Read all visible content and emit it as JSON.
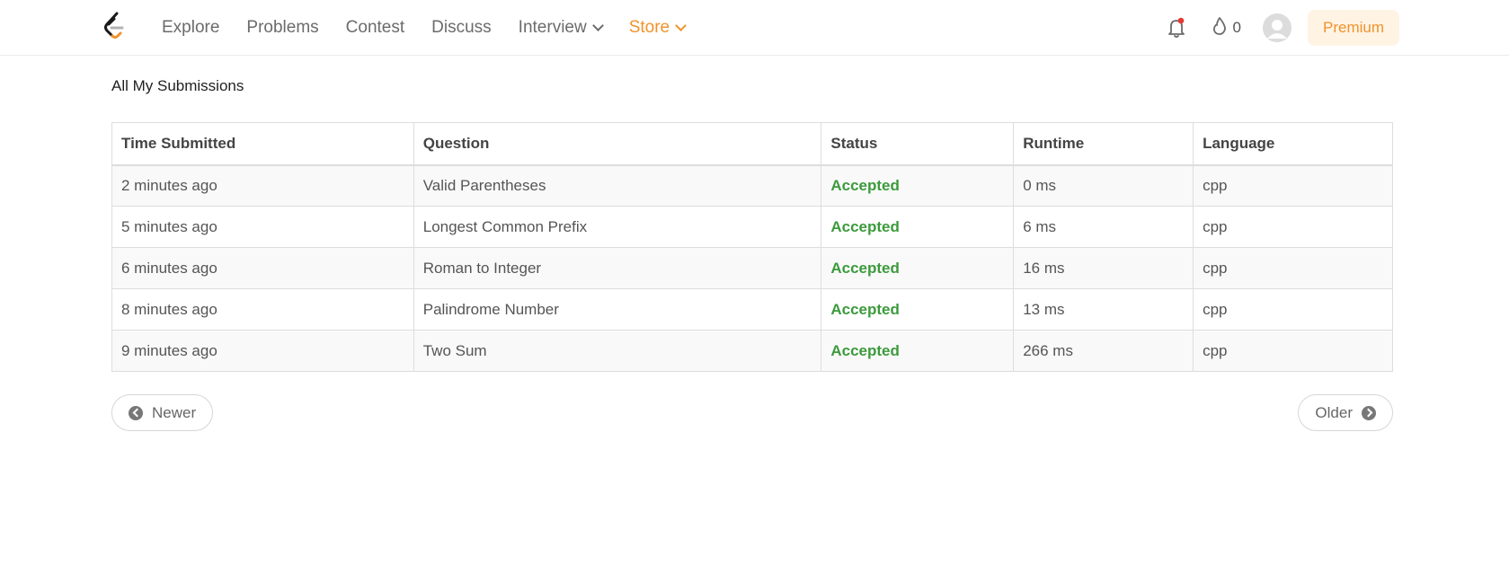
{
  "nav": {
    "items": [
      {
        "label": "Explore",
        "dropdown": false
      },
      {
        "label": "Problems",
        "dropdown": false
      },
      {
        "label": "Contest",
        "dropdown": false
      },
      {
        "label": "Discuss",
        "dropdown": false
      },
      {
        "label": "Interview",
        "dropdown": true
      },
      {
        "label": "Store",
        "dropdown": true
      }
    ],
    "streak_count": "0",
    "premium_label": "Premium",
    "notification_dot": true
  },
  "colors": {
    "accent_orange": "#f0932b",
    "accepted_green": "#3c9a3c",
    "notification_red": "#e53935"
  },
  "page": {
    "title": "All My Submissions"
  },
  "table": {
    "headers": {
      "time": "Time Submitted",
      "question": "Question",
      "status": "Status",
      "runtime": "Runtime",
      "language": "Language"
    },
    "rows": [
      {
        "time": "2 minutes ago",
        "question": "Valid Parentheses",
        "status": "Accepted",
        "runtime": "0 ms",
        "language": "cpp"
      },
      {
        "time": "5 minutes ago",
        "question": "Longest Common Prefix",
        "status": "Accepted",
        "runtime": "6 ms",
        "language": "cpp"
      },
      {
        "time": "6 minutes ago",
        "question": "Roman to Integer",
        "status": "Accepted",
        "runtime": "16 ms",
        "language": "cpp"
      },
      {
        "time": "8 minutes ago",
        "question": "Palindrome Number",
        "status": "Accepted",
        "runtime": "13 ms",
        "language": "cpp"
      },
      {
        "time": "9 minutes ago",
        "question": "Two Sum",
        "status": "Accepted",
        "runtime": "266 ms",
        "language": "cpp"
      }
    ]
  },
  "pagination": {
    "newer_label": "Newer",
    "older_label": "Older"
  }
}
